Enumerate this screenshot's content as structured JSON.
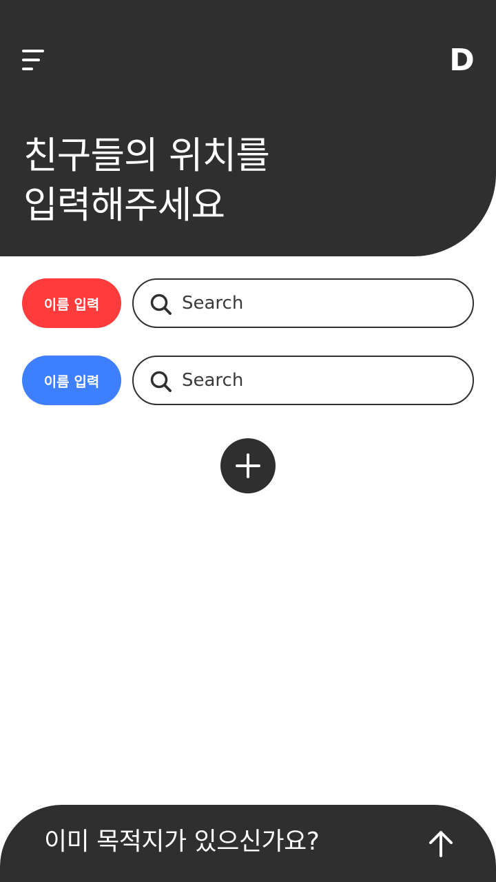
{
  "header": {
    "menu_icon": "hamburger-menu-icon",
    "logo_text": "D",
    "title_line1": "친구들의 위치를",
    "title_line2": "입력해주세요",
    "background_color": "#2f2f2f"
  },
  "friends": [
    {
      "name_label": "이름 입력",
      "color": "#ff3b3b",
      "search_placeholder": "Search",
      "search_value": ""
    },
    {
      "name_label": "이름 입력",
      "color": "#3d7fff",
      "search_placeholder": "Search",
      "search_value": ""
    }
  ],
  "add_button": {
    "icon": "plus-icon"
  },
  "bottom_bar": {
    "text": "이미 목적지가 있으신가요?",
    "icon": "arrow-up-icon"
  }
}
